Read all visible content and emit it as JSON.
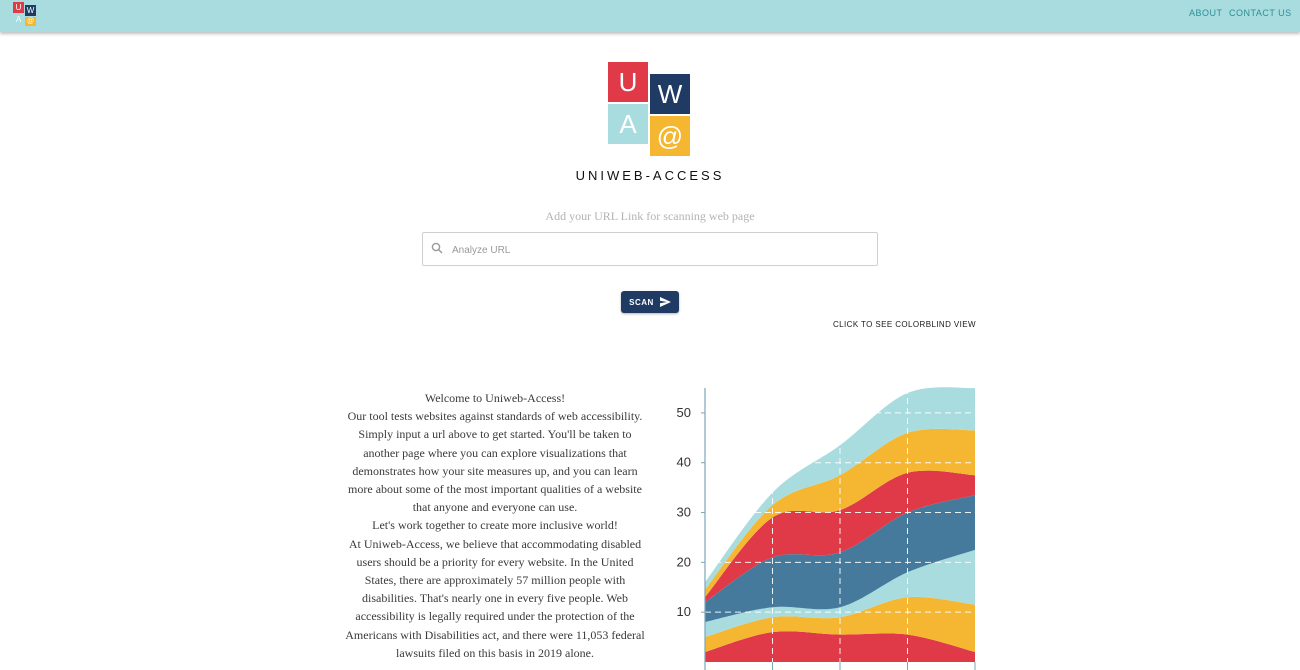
{
  "topbar": {
    "logo_letters": [
      "U",
      "W",
      "A",
      "@"
    ],
    "nav": [
      {
        "label": "ABOUT"
      },
      {
        "label": "CONTACT US"
      }
    ]
  },
  "hero": {
    "logo_letters": [
      "U",
      "W",
      "A",
      "@"
    ],
    "brand_name": "UNIWEB-ACCESS",
    "hint": "Add your URL Link for scanning web page",
    "search_placeholder": "Analyze URL",
    "scan_label": "SCAN",
    "colorblind_label": "CLICK TO SEE COLORBLIND VIEW"
  },
  "welcome": {
    "lines": [
      "Welcome to Uniweb-Access!",
      "Our tool tests websites against standards of web accessibility. Simply input a url above to get started. You'll be taken to another page where you can explore visualizations that demonstrates how your site measures up, and you can learn more about some of the most important qualities of a website that anyone and everyone can use.",
      "Let's work together to create more inclusive world!",
      "At Uniweb-Access, we believe that accommodating disabled users should be a priority for every website. In the United States, there are approximately 57 million people with disabilities. That's nearly one in every five people. Web accessibility is legally required under the protection of the Americans with Disabilities act, and there were 11,053 federal lawsuits filed on this basis in 2019 alone."
    ]
  },
  "colors": {
    "red": "#e03a48",
    "navy": "#1f3a63",
    "teal": "#a8dcdf",
    "yellow": "#f5b731",
    "steel_blue": "#457a9c"
  },
  "chart_data": {
    "type": "area",
    "stacked": true,
    "x": [
      0,
      1,
      2,
      3,
      4
    ],
    "ylim": [
      0,
      55
    ],
    "yticks": [
      10,
      20,
      30,
      40,
      50
    ],
    "grid": true,
    "series": [
      {
        "color": "#e03a48",
        "values": [
          2,
          6,
          5.5,
          5.5,
          2
        ]
      },
      {
        "color": "#f5b731",
        "values": [
          3,
          3,
          3.5,
          7.5,
          9.5
        ]
      },
      {
        "color": "#a8dcdf",
        "values": [
          3,
          2,
          2,
          5,
          11
        ]
      },
      {
        "color": "#457a9c",
        "values": [
          4,
          10,
          11,
          12,
          11
        ]
      },
      {
        "color": "#e03a48",
        "values": [
          1,
          8,
          8.5,
          8,
          4
        ]
      },
      {
        "color": "#f5b731",
        "values": [
          1.5,
          2.5,
          7,
          8,
          9
        ]
      },
      {
        "color": "#a8dcdf",
        "values": [
          1.5,
          2.5,
          6,
          8,
          8.5
        ]
      }
    ]
  }
}
